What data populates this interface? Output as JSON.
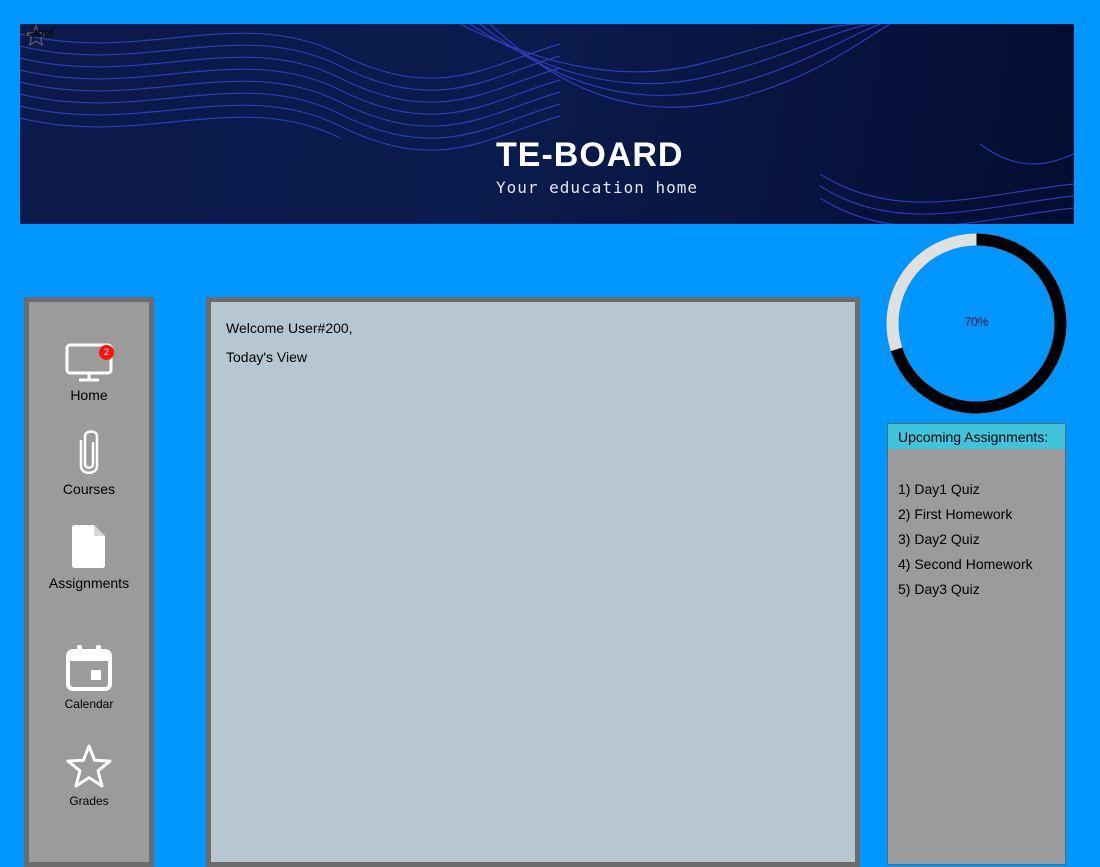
{
  "corner": {
    "label": "Label"
  },
  "banner": {
    "title": "TE-BOARD",
    "subtitle": "Your education home"
  },
  "nav": [
    {
      "label": "Home",
      "icon": "monitor-icon",
      "badge": "2"
    },
    {
      "label": "Courses",
      "icon": "paperclip-icon"
    },
    {
      "label": "Assignments",
      "icon": "document-icon"
    },
    {
      "label": "Calendar",
      "icon": "calendar-icon"
    },
    {
      "label": "Grades",
      "icon": "star-icon"
    }
  ],
  "main": {
    "welcome": "Welcome User#200,",
    "subtitle": "Today's View"
  },
  "progress": {
    "label": "70%",
    "value": 0.7
  },
  "assignments": {
    "header": "Upcoming Assignments:",
    "items": [
      "1) Day1 Quiz",
      "2) First Homework",
      "3) Day2 Quiz",
      "4) Second Homework",
      "5) Day3 Quiz"
    ]
  },
  "colors": {
    "background": "#0096ff",
    "sidebar": "#9b9b9b",
    "main_panel": "#b6c7d1",
    "assignments_header": "#3ec5dc",
    "badge": "#ff1010"
  }
}
